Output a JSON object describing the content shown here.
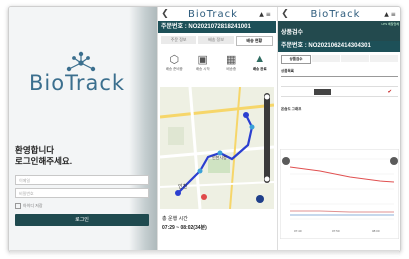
{
  "login": {
    "logo": "BioTrack",
    "welcome_line1": "환영합니다",
    "welcome_line2": "로그인해주세요.",
    "id_placeholder": "이메일",
    "pw_placeholder": "비밀번호",
    "remember_label": "아이디 저장",
    "login_button": "로그인"
  },
  "phone1": {
    "title": "BioTrack",
    "order_no": "주문번호 : NO2021072818241001",
    "tabs": [
      {
        "label": "주문 정보",
        "active": false
      },
      {
        "label": "배송 정보",
        "active": false
      },
      {
        "label": "배송 현황",
        "active": true
      }
    ],
    "steps": [
      {
        "icon": "box-icon",
        "label": "배송 준비중",
        "active": false
      },
      {
        "icon": "truck-icon",
        "label": "배송 시작",
        "active": false
      },
      {
        "icon": "delivery-truck-icon",
        "label": "배송중",
        "active": false
      },
      {
        "icon": "delivered-icon",
        "label": "배송 완료",
        "active": true
      }
    ],
    "map_labels": [
      "인천",
      "인천시청"
    ],
    "trip_label": "총 운행 시간",
    "trip_value": "07:29 ~ 08:02(34분)"
  },
  "phone2": {
    "title": "BioTrack",
    "badge": "LPS 배달업체",
    "header": "상품검수",
    "order_no": "주문번호 : NO2021062414304301",
    "tabs": [
      {
        "label": "상품검수",
        "active": true
      },
      {
        "label": "",
        "active": false
      },
      {
        "label": "",
        "active": false
      },
      {
        "label": "",
        "active": false
      }
    ],
    "section1": "상품목록",
    "section2": "온습도 그래프",
    "chart_ticks": [
      "07:40",
      "07:50",
      "08:00"
    ]
  }
}
